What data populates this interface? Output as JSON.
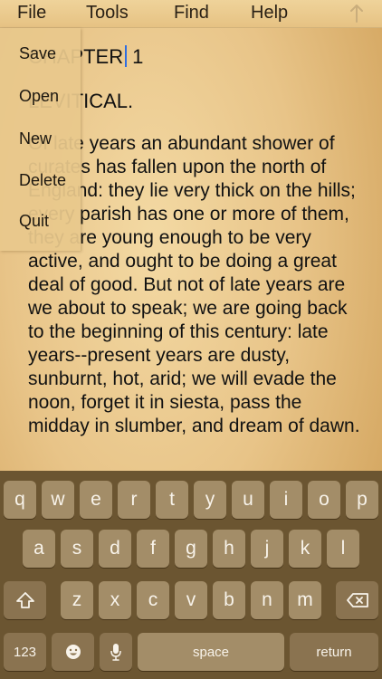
{
  "menubar": {
    "file": "File",
    "tools": "Tools",
    "find": "Find",
    "help": "Help",
    "scroll_icon": "up-arrow-icon"
  },
  "file_menu": {
    "items": [
      "Save",
      "Open",
      "New",
      "Delete",
      "Quit"
    ]
  },
  "document": {
    "chapter": "CHAPTER",
    "chapter_number": "1",
    "subtitle": "LEVITICAL.",
    "body": "Of late years an abundant shower of curates has fallen upon the north of England: they lie very thick on the hills; every parish has one or more of them, they are young enough to be very active, and ought to be doing a great deal of good. But not of late years are we about to speak; we are going back to the beginning of this century: late years--present years are dusty, sunburnt, hot, arid; we will evade the noon, forget it in siesta, pass the midday in slumber, and dream of dawn."
  },
  "keyboard": {
    "row1": [
      "q",
      "w",
      "e",
      "r",
      "t",
      "y",
      "u",
      "i",
      "o",
      "p"
    ],
    "row2": [
      "a",
      "s",
      "d",
      "f",
      "g",
      "h",
      "j",
      "k",
      "l"
    ],
    "row3": [
      "z",
      "x",
      "c",
      "v",
      "b",
      "n",
      "m"
    ],
    "numbers": "123",
    "space": "space",
    "return": "return",
    "icons": {
      "shift": "shift-icon",
      "backspace": "backspace-icon",
      "emoji": "emoji-icon",
      "mic": "microphone-icon"
    }
  }
}
